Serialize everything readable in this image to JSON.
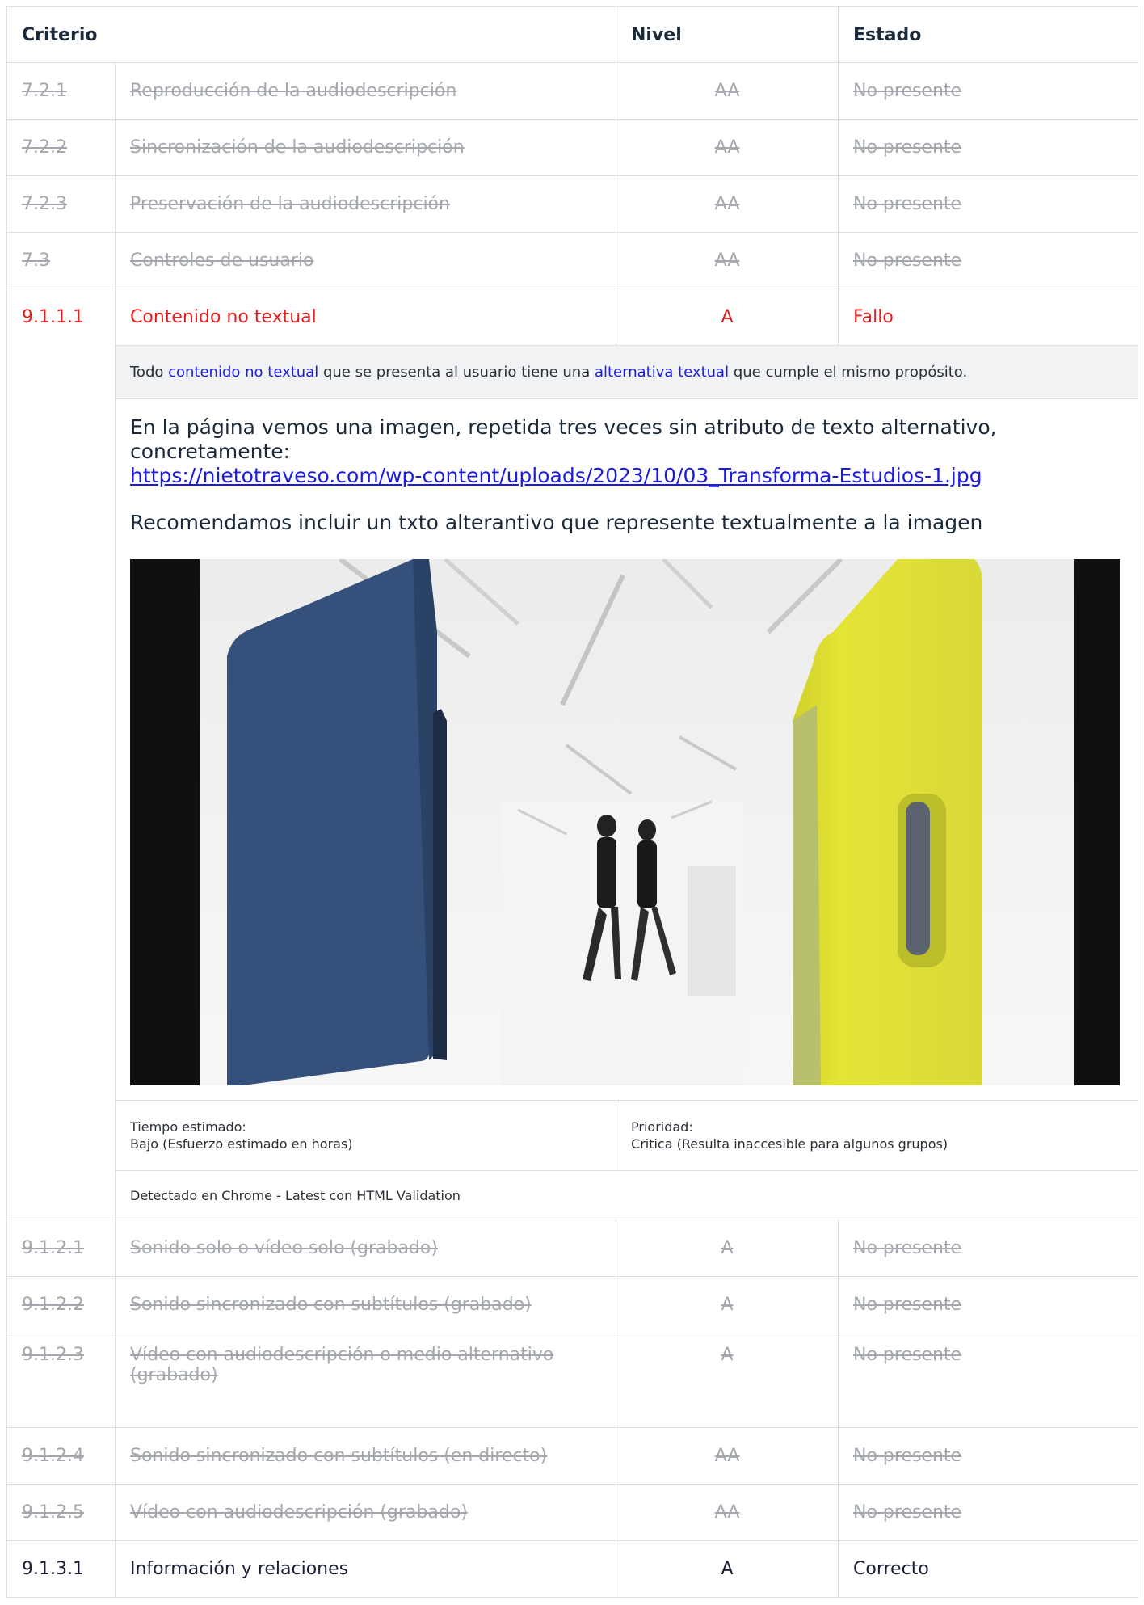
{
  "header": {
    "criterio": "Criterio",
    "nivel": "Nivel",
    "estado": "Estado"
  },
  "rows_before": [
    {
      "id": "7.2.1",
      "name": "Reproducción de la audiodescripción",
      "level": "AA",
      "status": "No presente"
    },
    {
      "id": "7.2.2",
      "name": "Sincronización de la audiodescripción",
      "level": "AA",
      "status": "No presente"
    },
    {
      "id": "7.2.3",
      "name": "Preservación de la audiodescripción",
      "level": "AA",
      "status": "No presente"
    },
    {
      "id": "7.3",
      "name": "Controles de usuario",
      "level": "AA",
      "status": "No presente"
    }
  ],
  "failed": {
    "id": "9.1.1.1",
    "name": "Contenido no textual",
    "level": "A",
    "status": "Fallo",
    "description": {
      "pre": "Todo ",
      "link1": "contenido no textual",
      "mid": " que se presenta al usuario tiene una ",
      "link2": "alternativa textual",
      "post": " que cumple el mismo propósito."
    },
    "comment": "En la página vemos una imagen, repetida tres veces sin atributo de texto alternativo, concretamente:",
    "url": "https://nietotraveso.com/wp-content/uploads/2023/10/03_Transforma-Estudios-1.jpg",
    "recommendation": "Recomendamos incluir un txto alterantivo que represente textualmente a la imagen",
    "time_label": "Tiempo estimado:",
    "time_value": "Bajo (Esfuerzo estimado en horas)",
    "priority_label": "Prioridad:",
    "priority_value": "Critica (Resulta inaccesible para algunos grupos)",
    "detected": "Detectado en Chrome - Latest con HTML Validation"
  },
  "rows_after": [
    {
      "id": "9.1.2.1",
      "name": "Sonido solo o vídeo solo (grabado)",
      "level": "A",
      "status": "No presente"
    },
    {
      "id": "9.1.2.2",
      "name": "Sonido sincronizado con subtítulos (grabado)",
      "level": "A",
      "status": "No presente"
    },
    {
      "id": "9.1.2.3",
      "name": "Vídeo con audiodescripción o medio alternativo (grabado)",
      "level": "A",
      "status": "No presente"
    },
    {
      "id": "9.1.2.4",
      "name": "Sonido sincronizado con subtítulos (en directo)",
      "level": "AA",
      "status": "No presente"
    },
    {
      "id": "9.1.2.5",
      "name": "Vídeo con audiodescripción (grabado)",
      "level": "AA",
      "status": "No presente"
    }
  ],
  "last": {
    "id": "9.1.3.1",
    "name": "Información y relaciones",
    "level": "A",
    "status": "Correcto"
  },
  "colors": {
    "fail": "#e02020",
    "link": "#1c1ce0",
    "muted": "#a4a8ae",
    "blue_volume": "#3a5580",
    "yellow_volume": "#dede34"
  }
}
